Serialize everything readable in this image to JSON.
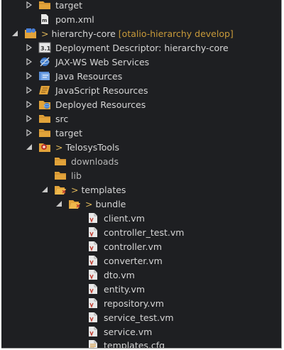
{
  "tree": {
    "target_top": "target",
    "pom": "pom.xml",
    "project": {
      "git_prefix": ">",
      "name": "hierarchy-core",
      "repo_tag": "[otalio-hierarchy develop]"
    },
    "deployment_descriptor": "Deployment Descriptor: hierarchy-core",
    "jaxws": "JAX-WS Web Services",
    "java_resources": "Java Resources",
    "javascript_resources": "JavaScript Resources",
    "deployed_resources": "Deployed Resources",
    "src": "src",
    "target": "target",
    "telosys": {
      "git_prefix": ">",
      "name": "TelosysTools"
    },
    "downloads": "downloads",
    "lib": "lib",
    "templates": {
      "git_prefix": ">",
      "name": "templates"
    },
    "bundle": {
      "git_prefix": ">",
      "name": "bundle"
    },
    "files": [
      "client.vm",
      "controller_test.vm",
      "controller.vm",
      "converter.vm",
      "dto.vm",
      "entity.vm",
      "repository.vm",
      "service_test.vm",
      "service.vm",
      "templates.cfg"
    ]
  },
  "colors": {
    "background": "#1e1f22",
    "text": "#d6d6d6",
    "folder": "#e2a33a",
    "git_decoration": "#c89a3a",
    "file_icon": "#e8e8e8"
  }
}
